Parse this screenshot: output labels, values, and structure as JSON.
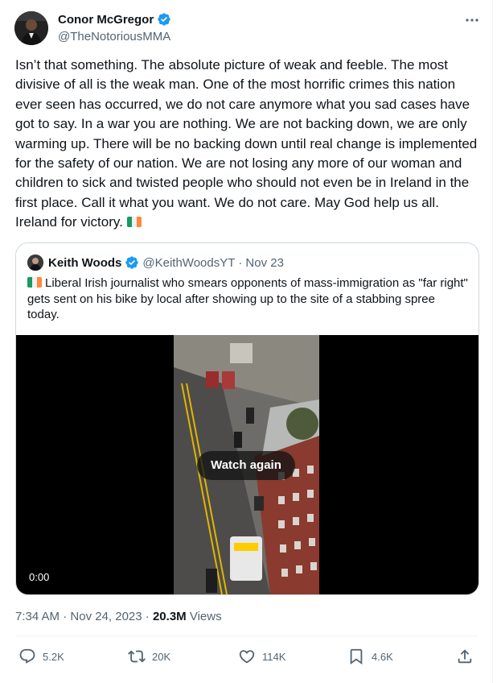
{
  "author": {
    "name": "Conor McGregor",
    "handle": "@TheNotoriousMMA"
  },
  "tweet": {
    "text": "Isn’t that something. The absolute picture of weak and feeble. The most divisive of all is the weak man. One of the most horrific crimes this nation ever seen has occurred, we do not care anymore what you sad cases have got to say. In a war you are nothing. We are not backing down, we are only warming up. There will be no backing down until real change is implemented for the safety of our nation. We are not losing any more of our woman and children to sick and twisted people who should not even be in Ireland in the first place. Call it what you want. We do not care. May God help us all. Ireland for victory."
  },
  "quote": {
    "name": "Keith Woods",
    "handle": "@KeithWoodsYT",
    "separator": "·",
    "date": "Nov 23",
    "text": "Liberal Irish journalist who smears opponents of mass-immigration as \"far right\" gets sent on his bike by local after showing up to the site of a stabbing spree today.",
    "video": {
      "watch_label": "Watch again",
      "timecode": "0:00"
    }
  },
  "meta": {
    "time": "7:34 AM",
    "separator": "·",
    "date": "Nov 24, 2023",
    "views_count": "20.3M",
    "views_label": "Views"
  },
  "actions": {
    "replies": "5.2K",
    "reposts": "20K",
    "likes": "114K",
    "bookmarks": "4.6K"
  },
  "colors": {
    "verified": "#1d9bf0",
    "text": "#0f1419",
    "secondary": "#536471",
    "flag_green": "#169b62",
    "flag_white": "#ffffff",
    "flag_orange": "#ff883e"
  }
}
